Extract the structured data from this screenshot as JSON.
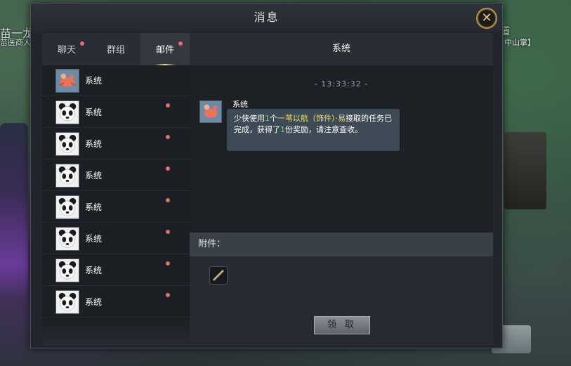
{
  "background": {
    "left_name": "苗一龙",
    "left_sub": "苗医商人",
    "right_name": "道",
    "right_sub": "中山掌】"
  },
  "window": {
    "title": "消息",
    "close_icon": "close-x-icon"
  },
  "tabs": [
    {
      "label": "聊天",
      "unread": true
    },
    {
      "label": "群组",
      "unread": false
    },
    {
      "label": "邮件",
      "unread": true,
      "active": true
    }
  ],
  "mail_list": [
    {
      "label": "系统",
      "icon": "system-crab-icon",
      "unread": false
    },
    {
      "label": "系统",
      "icon": "panda-icon",
      "unread": true
    },
    {
      "label": "系统",
      "icon": "panda-icon",
      "unread": true
    },
    {
      "label": "系统",
      "icon": "panda-icon",
      "unread": true
    },
    {
      "label": "系统",
      "icon": "panda-icon",
      "unread": true
    },
    {
      "label": "系统",
      "icon": "panda-icon",
      "unread": true
    },
    {
      "label": "系统",
      "icon": "panda-icon",
      "unread": true
    },
    {
      "label": "系统",
      "icon": "panda-icon",
      "unread": true
    }
  ],
  "detail": {
    "header": "系统",
    "timestamp": "- 13:33:32 -",
    "sender": "系统",
    "message": {
      "p1": "少侠使用",
      "n1": "1",
      "p2": "个",
      "item": "一苇以航（饰件）",
      "p3": "·",
      "p4": "易",
      "p5": "接取的任务已完成，获得了",
      "n2": "1",
      "p6": "份奖励，请注意查收。"
    }
  },
  "attachment": {
    "label": "附件：",
    "slot_icon": "blade-item-icon"
  },
  "claim_button": "领 取",
  "colors": {
    "highlight_yellow": "#f0e05a",
    "highlight_green": "#6ad06a",
    "unread_dot": "#e0706a",
    "tab_underline": "#f3d38c"
  }
}
